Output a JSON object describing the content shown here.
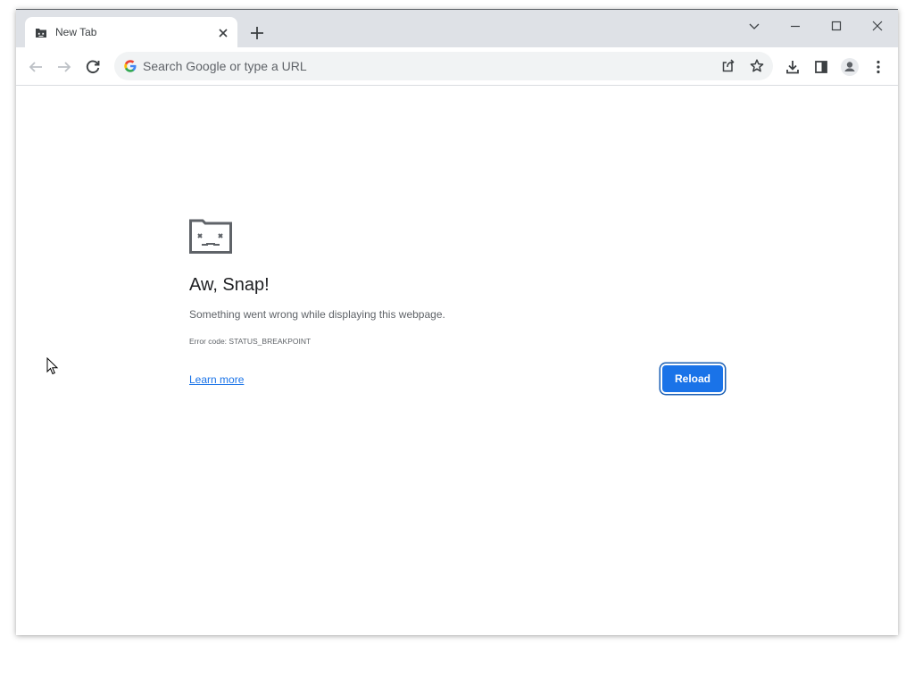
{
  "tab": {
    "title": "New Tab",
    "favicon": "sad-tab-icon",
    "close_icon": "close-icon"
  },
  "window_controls": [
    "chevron-down-icon",
    "minimize-icon",
    "maximize-icon",
    "close-icon"
  ],
  "toolbar": {
    "back_icon": "back-arrow-icon",
    "forward_icon": "forward-arrow-icon",
    "reload_icon": "reload-icon",
    "omnibox": {
      "placeholder": "Search Google or type a URL",
      "value": ""
    },
    "right_icons": [
      "share-icon",
      "bookmark-star-icon",
      "download-icon",
      "side-panel-icon",
      "profile-icon",
      "menu-icon"
    ]
  },
  "error_page": {
    "icon": "sad-tab-icon",
    "heading": "Aw, Snap!",
    "message": "Something went wrong while displaying this webpage.",
    "error_code": "Error code: STATUS_BREAKPOINT",
    "learn_more": "Learn more",
    "reload_label": "Reload"
  },
  "colors": {
    "accent": "#1a73e8",
    "tabstrip": "#dee1e6",
    "omnibox": "#f1f3f4",
    "text_primary": "#202124",
    "text_secondary": "#5f6368"
  }
}
